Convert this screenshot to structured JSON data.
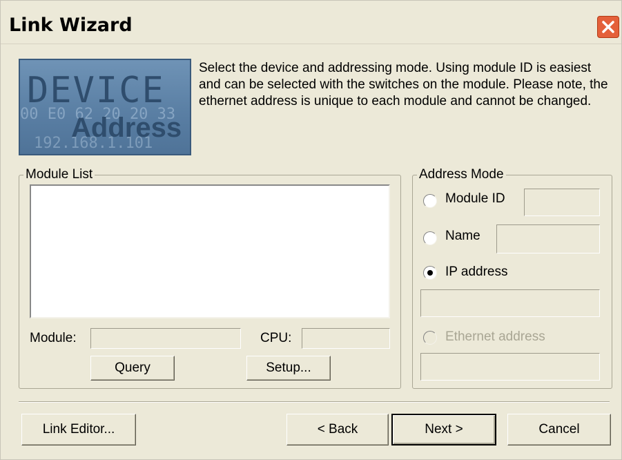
{
  "window": {
    "title": "Link Wizard"
  },
  "banner": {
    "word1": "DEVICE",
    "word2": "Address",
    "hex_text": "00 E0 62 20 20 33",
    "ip_text": "192.168.1.101"
  },
  "description": "Select the device and addressing mode. Using module ID is easiest and can be selected with the switches on the module. Please note, the ethernet address is unique to each module and cannot be changed.",
  "module_list": {
    "legend": "Module List",
    "items": [],
    "module_label": "Module:",
    "module_value": "",
    "cpu_label": "CPU:",
    "cpu_value": "",
    "query_label": "Query",
    "setup_label": "Setup..."
  },
  "address_mode": {
    "legend": "Address Mode",
    "module_id_label": "Module ID",
    "module_id_value": "",
    "name_label": "Name",
    "name_value": "",
    "ip_label": "IP address",
    "ip_value": "",
    "ethernet_label": "Ethernet address",
    "ethernet_value": "",
    "selected": "IP address"
  },
  "footer": {
    "link_editor_label": "Link Editor...",
    "back_label": "< Back",
    "next_label": "Next >",
    "cancel_label": "Cancel"
  }
}
